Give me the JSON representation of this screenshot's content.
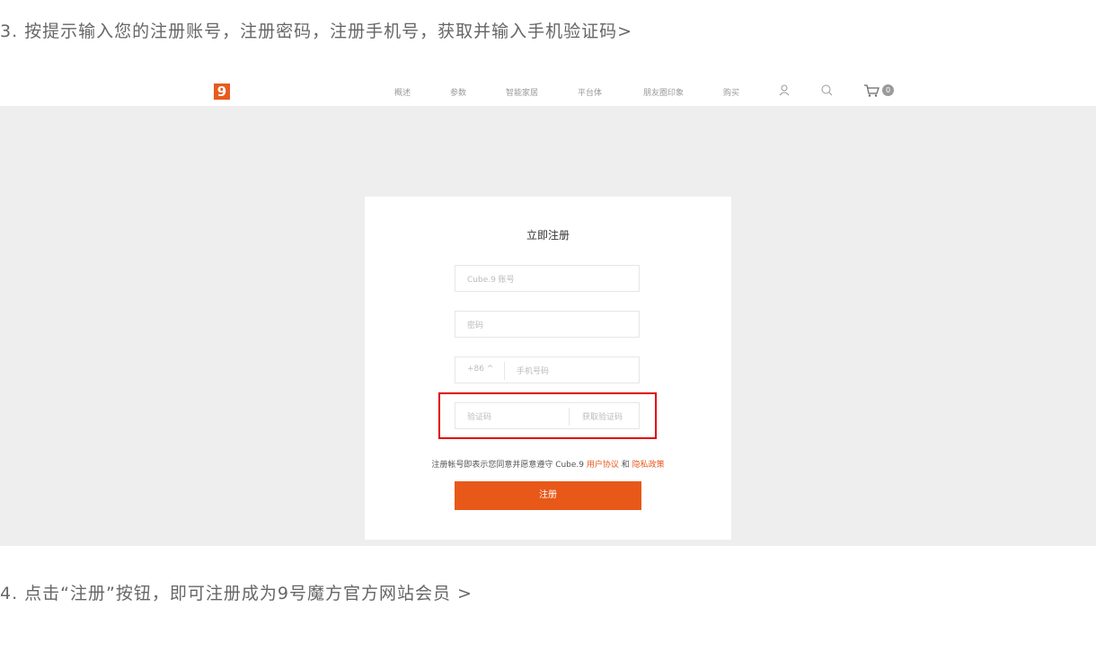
{
  "steps": {
    "step3": "3. 按提示输入您的注册账号，注册密码，注册手机号，获取并输入手机验证码>",
    "step4": "4. 点击“注册”按钮，即可注册成为9号魔方官方网站会员  >"
  },
  "nav": {
    "logo": "9",
    "items": [
      "概述",
      "参数",
      "智能家居",
      "平台体",
      "朋友圈印象",
      "购买"
    ],
    "cart_count": "0"
  },
  "form": {
    "title": "立即注册",
    "account_placeholder": "Cube.9 账号",
    "password_placeholder": "密码",
    "country_code": "+86 ^",
    "phone_placeholder": "手机号码",
    "code_placeholder": "验证码",
    "get_code": "获取验证码",
    "agree_prefix": "注册帐号即表示您同意并愿意遵守 Cube.9 ",
    "user_agreement": "用户协议",
    "and": " 和 ",
    "privacy_policy": "隐私政策",
    "submit": "注册"
  },
  "colors": {
    "accent": "#e85818",
    "highlight_box": "#e00000",
    "background_band": "#eeeeee"
  }
}
